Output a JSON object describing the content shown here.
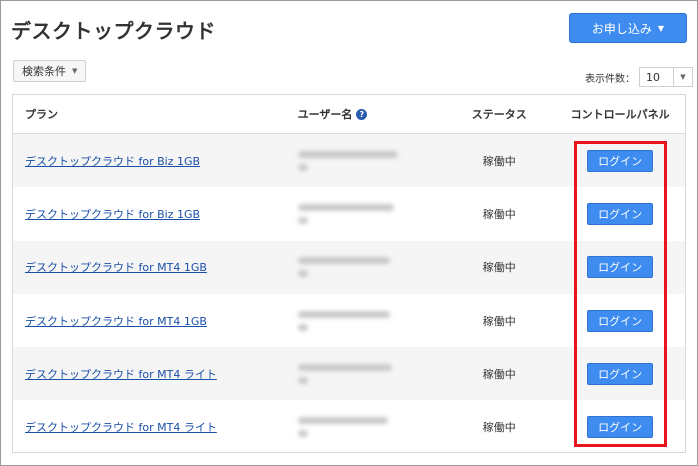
{
  "page": {
    "title": "デスクトップクラウド",
    "apply_button": "お申し込み",
    "filter_button": "検索条件"
  },
  "per_page": {
    "label": "表示件数：",
    "value": "10"
  },
  "table": {
    "headers": {
      "plan": "プラン",
      "user": "ユーザー名",
      "status": "ステータス",
      "panel": "コントロールパネル"
    },
    "rows": [
      {
        "plan": "デスクトップクラウド for Biz 1GB",
        "status": "稼働中",
        "action": "ログイン"
      },
      {
        "plan": "デスクトップクラウド for Biz 1GB",
        "status": "稼働中",
        "action": "ログイン"
      },
      {
        "plan": "デスクトップクラウド for MT4 1GB",
        "status": "稼働中",
        "action": "ログイン"
      },
      {
        "plan": "デスクトップクラウド for MT4 1GB",
        "status": "稼働中",
        "action": "ログイン"
      },
      {
        "plan": "デスクトップクラウド for MT4 ライト",
        "status": "稼働中",
        "action": "ログイン"
      },
      {
        "plan": "デスクトップクラウド for MT4 ライト",
        "status": "稼働中",
        "action": "ログイン"
      }
    ]
  },
  "colors": {
    "primary_button": "#3f8cf0",
    "link": "#1a4fa8",
    "highlight": "#e8141e"
  },
  "icons": {
    "help": "question-circle-icon",
    "caret": "caret-down-icon"
  }
}
